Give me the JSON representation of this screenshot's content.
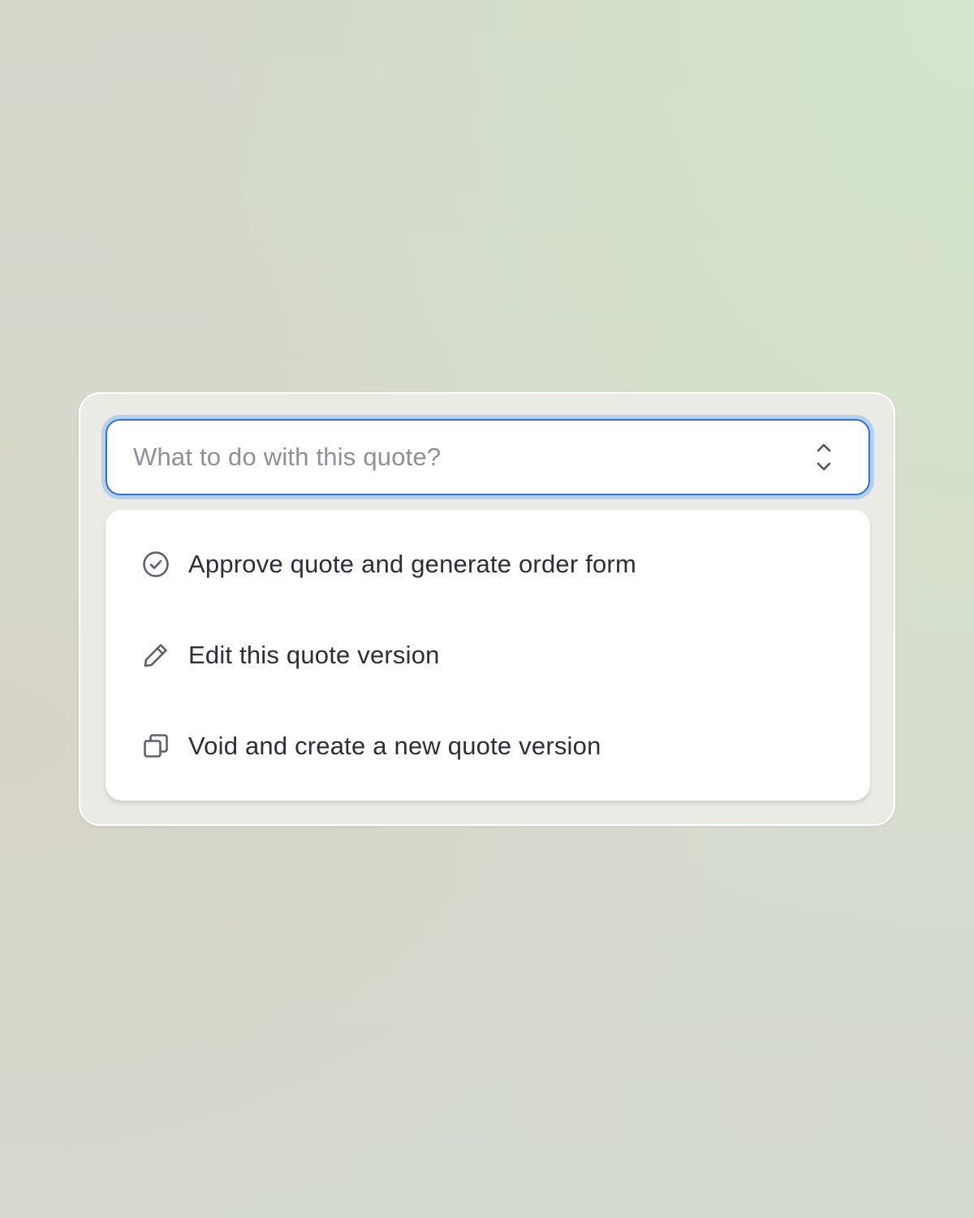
{
  "select": {
    "placeholder": "What to do with this quote?",
    "toggle_icon": "chevron-up-down-icon",
    "focus_color": "#2f6fde"
  },
  "menu": {
    "items": [
      {
        "label": "Approve quote and generate order form",
        "icon": "check-circle-icon"
      },
      {
        "label": "Edit this quote version",
        "icon": "pencil-icon"
      },
      {
        "label": "Void and create a new quote version",
        "icon": "duplicate-icon"
      }
    ]
  }
}
